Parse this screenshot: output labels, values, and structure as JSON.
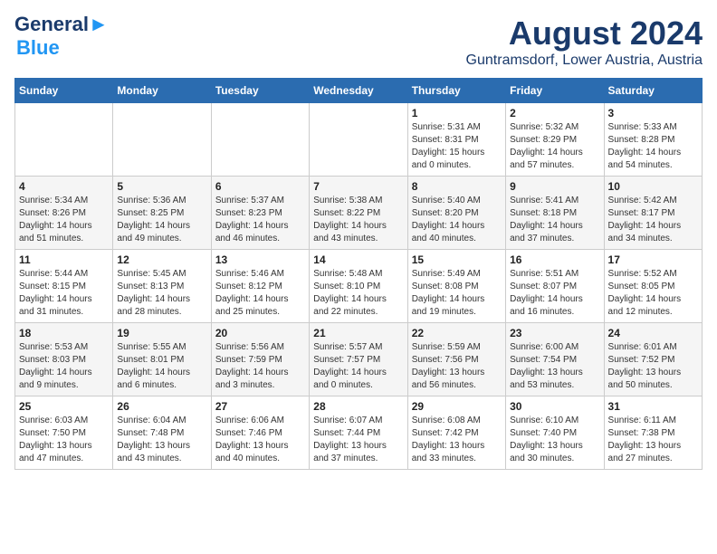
{
  "logo": {
    "line1": "General",
    "line2": "Blue"
  },
  "title": "August 2024",
  "subtitle": "Guntramsdorf, Lower Austria, Austria",
  "weekdays": [
    "Sunday",
    "Monday",
    "Tuesday",
    "Wednesday",
    "Thursday",
    "Friday",
    "Saturday"
  ],
  "weeks": [
    [
      {
        "day": "",
        "info": ""
      },
      {
        "day": "",
        "info": ""
      },
      {
        "day": "",
        "info": ""
      },
      {
        "day": "",
        "info": ""
      },
      {
        "day": "1",
        "info": "Sunrise: 5:31 AM\nSunset: 8:31 PM\nDaylight: 15 hours\nand 0 minutes."
      },
      {
        "day": "2",
        "info": "Sunrise: 5:32 AM\nSunset: 8:29 PM\nDaylight: 14 hours\nand 57 minutes."
      },
      {
        "day": "3",
        "info": "Sunrise: 5:33 AM\nSunset: 8:28 PM\nDaylight: 14 hours\nand 54 minutes."
      }
    ],
    [
      {
        "day": "4",
        "info": "Sunrise: 5:34 AM\nSunset: 8:26 PM\nDaylight: 14 hours\nand 51 minutes."
      },
      {
        "day": "5",
        "info": "Sunrise: 5:36 AM\nSunset: 8:25 PM\nDaylight: 14 hours\nand 49 minutes."
      },
      {
        "day": "6",
        "info": "Sunrise: 5:37 AM\nSunset: 8:23 PM\nDaylight: 14 hours\nand 46 minutes."
      },
      {
        "day": "7",
        "info": "Sunrise: 5:38 AM\nSunset: 8:22 PM\nDaylight: 14 hours\nand 43 minutes."
      },
      {
        "day": "8",
        "info": "Sunrise: 5:40 AM\nSunset: 8:20 PM\nDaylight: 14 hours\nand 40 minutes."
      },
      {
        "day": "9",
        "info": "Sunrise: 5:41 AM\nSunset: 8:18 PM\nDaylight: 14 hours\nand 37 minutes."
      },
      {
        "day": "10",
        "info": "Sunrise: 5:42 AM\nSunset: 8:17 PM\nDaylight: 14 hours\nand 34 minutes."
      }
    ],
    [
      {
        "day": "11",
        "info": "Sunrise: 5:44 AM\nSunset: 8:15 PM\nDaylight: 14 hours\nand 31 minutes."
      },
      {
        "day": "12",
        "info": "Sunrise: 5:45 AM\nSunset: 8:13 PM\nDaylight: 14 hours\nand 28 minutes."
      },
      {
        "day": "13",
        "info": "Sunrise: 5:46 AM\nSunset: 8:12 PM\nDaylight: 14 hours\nand 25 minutes."
      },
      {
        "day": "14",
        "info": "Sunrise: 5:48 AM\nSunset: 8:10 PM\nDaylight: 14 hours\nand 22 minutes."
      },
      {
        "day": "15",
        "info": "Sunrise: 5:49 AM\nSunset: 8:08 PM\nDaylight: 14 hours\nand 19 minutes."
      },
      {
        "day": "16",
        "info": "Sunrise: 5:51 AM\nSunset: 8:07 PM\nDaylight: 14 hours\nand 16 minutes."
      },
      {
        "day": "17",
        "info": "Sunrise: 5:52 AM\nSunset: 8:05 PM\nDaylight: 14 hours\nand 12 minutes."
      }
    ],
    [
      {
        "day": "18",
        "info": "Sunrise: 5:53 AM\nSunset: 8:03 PM\nDaylight: 14 hours\nand 9 minutes."
      },
      {
        "day": "19",
        "info": "Sunrise: 5:55 AM\nSunset: 8:01 PM\nDaylight: 14 hours\nand 6 minutes."
      },
      {
        "day": "20",
        "info": "Sunrise: 5:56 AM\nSunset: 7:59 PM\nDaylight: 14 hours\nand 3 minutes."
      },
      {
        "day": "21",
        "info": "Sunrise: 5:57 AM\nSunset: 7:57 PM\nDaylight: 14 hours\nand 0 minutes."
      },
      {
        "day": "22",
        "info": "Sunrise: 5:59 AM\nSunset: 7:56 PM\nDaylight: 13 hours\nand 56 minutes."
      },
      {
        "day": "23",
        "info": "Sunrise: 6:00 AM\nSunset: 7:54 PM\nDaylight: 13 hours\nand 53 minutes."
      },
      {
        "day": "24",
        "info": "Sunrise: 6:01 AM\nSunset: 7:52 PM\nDaylight: 13 hours\nand 50 minutes."
      }
    ],
    [
      {
        "day": "25",
        "info": "Sunrise: 6:03 AM\nSunset: 7:50 PM\nDaylight: 13 hours\nand 47 minutes."
      },
      {
        "day": "26",
        "info": "Sunrise: 6:04 AM\nSunset: 7:48 PM\nDaylight: 13 hours\nand 43 minutes."
      },
      {
        "day": "27",
        "info": "Sunrise: 6:06 AM\nSunset: 7:46 PM\nDaylight: 13 hours\nand 40 minutes."
      },
      {
        "day": "28",
        "info": "Sunrise: 6:07 AM\nSunset: 7:44 PM\nDaylight: 13 hours\nand 37 minutes."
      },
      {
        "day": "29",
        "info": "Sunrise: 6:08 AM\nSunset: 7:42 PM\nDaylight: 13 hours\nand 33 minutes."
      },
      {
        "day": "30",
        "info": "Sunrise: 6:10 AM\nSunset: 7:40 PM\nDaylight: 13 hours\nand 30 minutes."
      },
      {
        "day": "31",
        "info": "Sunrise: 6:11 AM\nSunset: 7:38 PM\nDaylight: 13 hours\nand 27 minutes."
      }
    ]
  ]
}
